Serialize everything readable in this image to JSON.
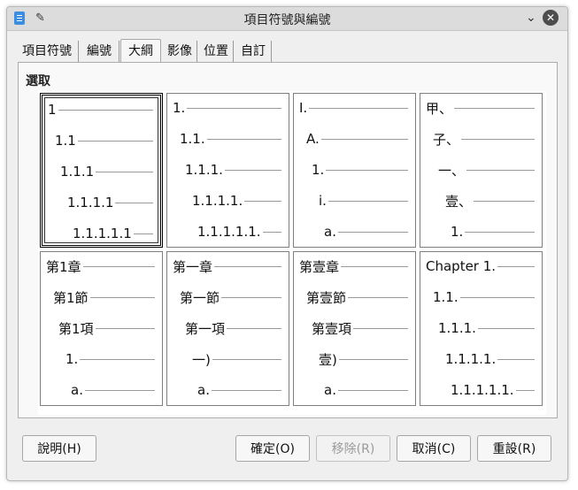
{
  "titlebar": {
    "title": "項目符號與編號"
  },
  "tabs": [
    {
      "label": "項目符號"
    },
    {
      "label": "編號"
    },
    {
      "label": "大綱"
    },
    {
      "label": "影像"
    },
    {
      "label": "位置"
    },
    {
      "label": "自訂"
    }
  ],
  "panel": {
    "section_label": "選取"
  },
  "cells": [
    {
      "lines": [
        "1",
        "1.1",
        "1.1.1",
        "1.1.1.1",
        "1.1.1.1.1"
      ]
    },
    {
      "lines": [
        "1.",
        "1.1.",
        "1.1.1.",
        "1.1.1.1.",
        "1.1.1.1.1."
      ]
    },
    {
      "lines": [
        "I.",
        "A.",
        "1.",
        "i.",
        "a."
      ]
    },
    {
      "lines": [
        "甲、",
        "子、",
        "一、",
        "壹、",
        "1."
      ]
    },
    {
      "lines": [
        "第1章",
        "第1節",
        "第1項",
        "1.",
        "a."
      ]
    },
    {
      "lines": [
        "第一章",
        "第一節",
        "第一項",
        "一)",
        "a."
      ]
    },
    {
      "lines": [
        "第壹章",
        "第壹節",
        "第壹項",
        "壹)",
        "a."
      ]
    },
    {
      "lines": [
        "Chapter 1.",
        "1.1.",
        "1.1.1.",
        "1.1.1.1.",
        "1.1.1.1.1."
      ]
    }
  ],
  "buttons": {
    "help": "說明(H)",
    "ok": "確定(O)",
    "delete": "移除(R)",
    "cancel": "取消(C)",
    "reset": "重設(R)"
  }
}
